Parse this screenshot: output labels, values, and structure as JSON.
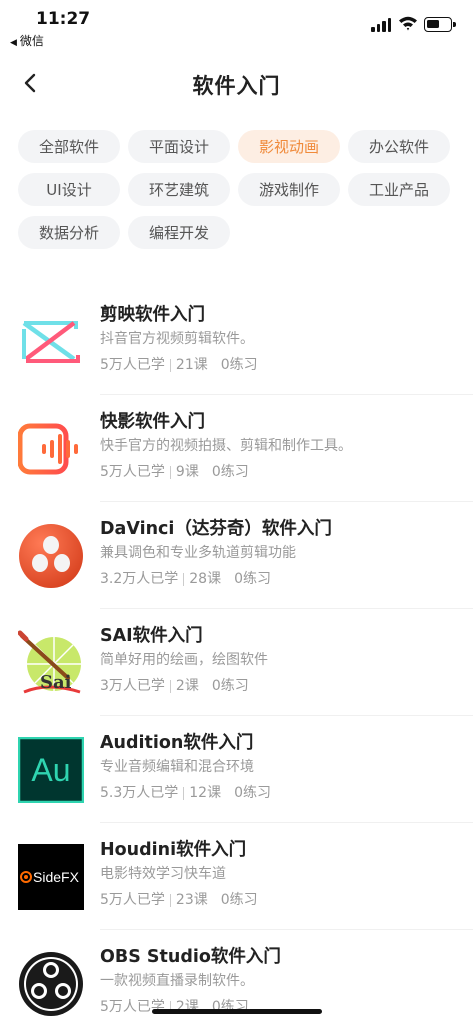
{
  "status_bar": {
    "time": "11:27",
    "back_app": "微信"
  },
  "nav": {
    "title": "软件入门"
  },
  "categories": [
    {
      "label": "全部软件",
      "active": false
    },
    {
      "label": "平面设计",
      "active": false
    },
    {
      "label": "影视动画",
      "active": true
    },
    {
      "label": "办公软件",
      "active": false
    },
    {
      "label": "UI设计",
      "active": false
    },
    {
      "label": "环艺建筑",
      "active": false
    },
    {
      "label": "游戏制作",
      "active": false
    },
    {
      "label": "工业产品",
      "active": false
    },
    {
      "label": "数据分析",
      "active": false
    },
    {
      "label": "编程开发",
      "active": false
    }
  ],
  "courses": [
    {
      "title": "剪映软件入门",
      "desc": "抖音官方视频剪辑软件。",
      "learners": "5万人已学",
      "lessons": "21课",
      "practice": "0练习",
      "icon": "capcut-logo"
    },
    {
      "title": "快影软件入门",
      "desc": "快手官方的视频拍摄、剪辑和制作工具。",
      "learners": "5万人已学",
      "lessons": "9课",
      "practice": "0练习",
      "icon": "kuaiying-logo"
    },
    {
      "title": "DaVinci（达芬奇）软件入门",
      "desc": "兼具调色和专业多轨道剪辑功能",
      "learners": "3.2万人已学",
      "lessons": "28课",
      "practice": "0练习",
      "icon": "davinci-logo"
    },
    {
      "title": "SAI软件入门",
      "desc": "简单好用的绘画，绘图软件",
      "learners": "3万人已学",
      "lessons": "2课",
      "practice": "0练习",
      "icon": "sai-logo",
      "logo_text": "Sai"
    },
    {
      "title": "Audition软件入门",
      "desc": "专业音频编辑和混合环境",
      "learners": "5.3万人已学",
      "lessons": "12课",
      "practice": "0练习",
      "icon": "audition-logo",
      "logo_text": "Au"
    },
    {
      "title": "Houdini软件入门",
      "desc": "电影特效学习快车道",
      "learners": "5万人已学",
      "lessons": "23课",
      "practice": "0练习",
      "icon": "sidefx-logo",
      "logo_text": "SideFX"
    },
    {
      "title": "OBS Studio软件入门",
      "desc": "一款视频直播录制软件。",
      "learners": "5万人已学",
      "lessons": "2课",
      "practice": "0练习",
      "icon": "obs-logo"
    }
  ],
  "colors": {
    "accent": "#f08a3a",
    "accent_bg": "#fdeee3",
    "chip_bg": "#f3f4f6"
  }
}
